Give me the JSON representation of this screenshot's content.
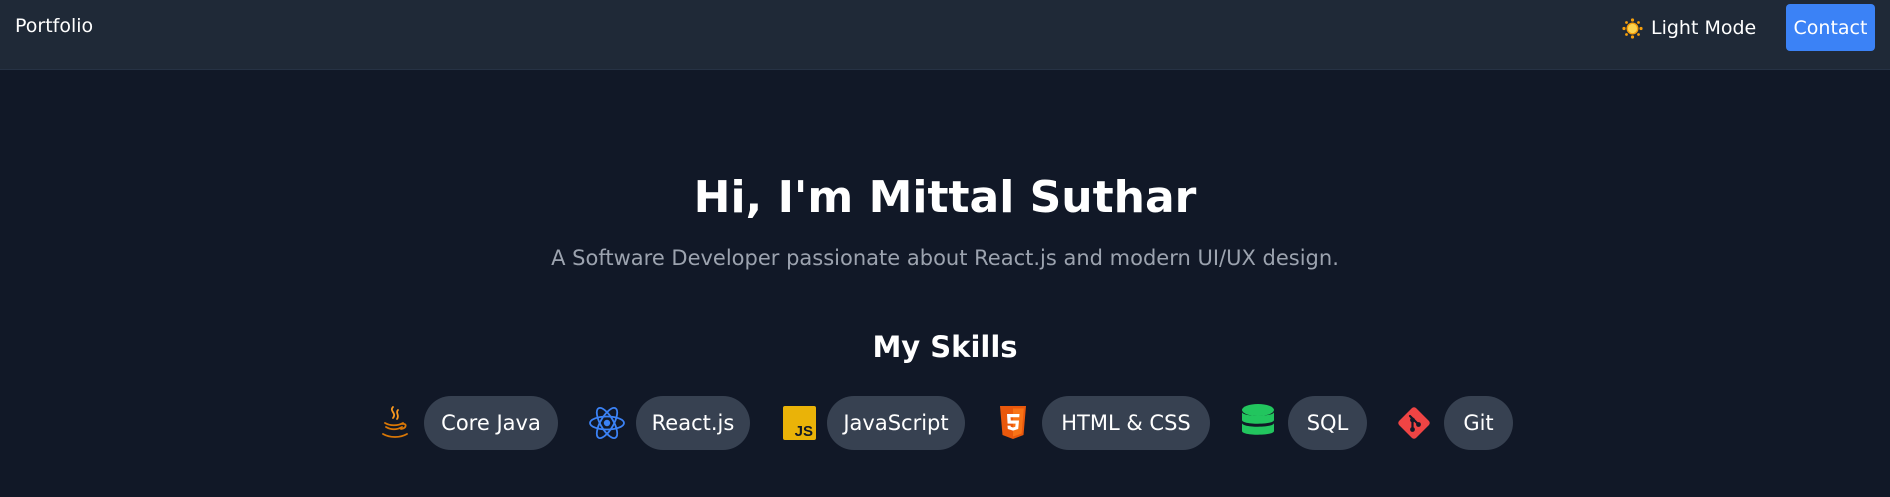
{
  "nav": {
    "brand": "Portfolio",
    "theme_toggle_label": "Light Mode",
    "theme_toggle_icon": "sun-icon",
    "contact_label": "Contact"
  },
  "hero": {
    "title": "Hi, I'm Mittal Suthar",
    "subtitle": "A Software Developer passionate about React.js and modern UI/UX design."
  },
  "skills": {
    "heading": "My Skills",
    "items": [
      {
        "label": "Core Java",
        "icon": "java-icon",
        "color": "#f89820"
      },
      {
        "label": "React.js",
        "icon": "react-icon",
        "color": "#3b82f6"
      },
      {
        "label": "JavaScript",
        "icon": "javascript-icon",
        "color": "#eab308"
      },
      {
        "label": "HTML & CSS",
        "icon": "html5-icon",
        "color": "#ea580c"
      },
      {
        "label": "SQL",
        "icon": "database-icon",
        "color": "#22c55e"
      },
      {
        "label": "Git",
        "icon": "git-icon",
        "color": "#ef4444"
      }
    ]
  },
  "colors": {
    "background": "#111827",
    "navbar": "#1f2937",
    "accent": "#3b82f6",
    "pill": "#374151",
    "muted_text": "#9ca3af"
  }
}
